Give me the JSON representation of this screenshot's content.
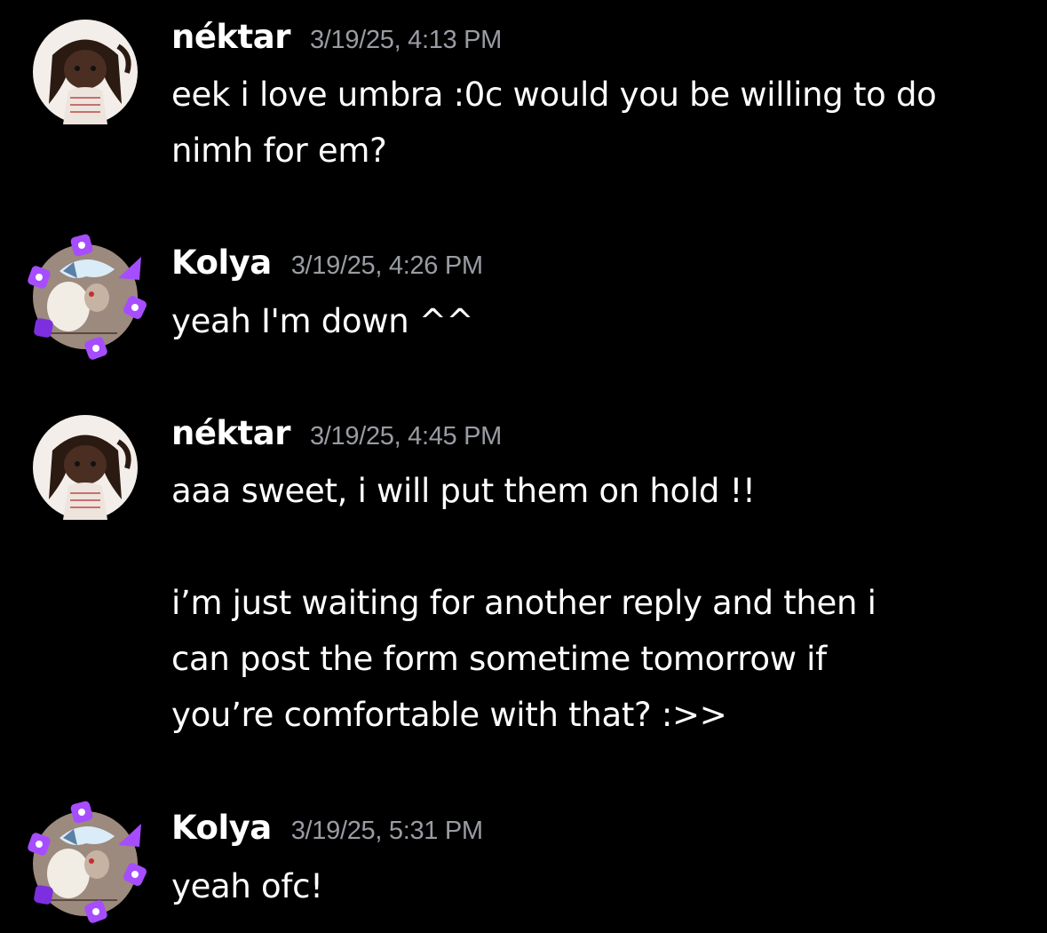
{
  "messages": [
    {
      "author": "néktar",
      "timestamp": "3/19/25, 4:13 PM",
      "text": "eek i love umbra :0c would you be willing to do\nnimh for em?",
      "avatar_icon": "nektar-avatar-icon"
    },
    {
      "author": "Kolya",
      "timestamp": "3/19/25, 4:26 PM",
      "text": "yeah I'm down ^^",
      "avatar_icon": "kolya-avatar-icon"
    },
    {
      "author": "néktar",
      "timestamp": "3/19/25, 4:45 PM",
      "text": "aaa sweet, i will put them on hold !!\n\ni’m just waiting for another reply and then i\ncan post the form sometime tomorrow if\nyou’re comfortable with that? :>>",
      "avatar_icon": "nektar-avatar-icon"
    },
    {
      "author": "Kolya",
      "timestamp": "3/19/25, 5:31 PM",
      "text": "yeah ofc!",
      "avatar_icon": "kolya-avatar-icon"
    }
  ],
  "colors": {
    "background": "#000000",
    "author": "#ffffff",
    "timestamp": "#9a9ca3",
    "text": "#ffffff",
    "decoration_accent": "#a64dff"
  }
}
